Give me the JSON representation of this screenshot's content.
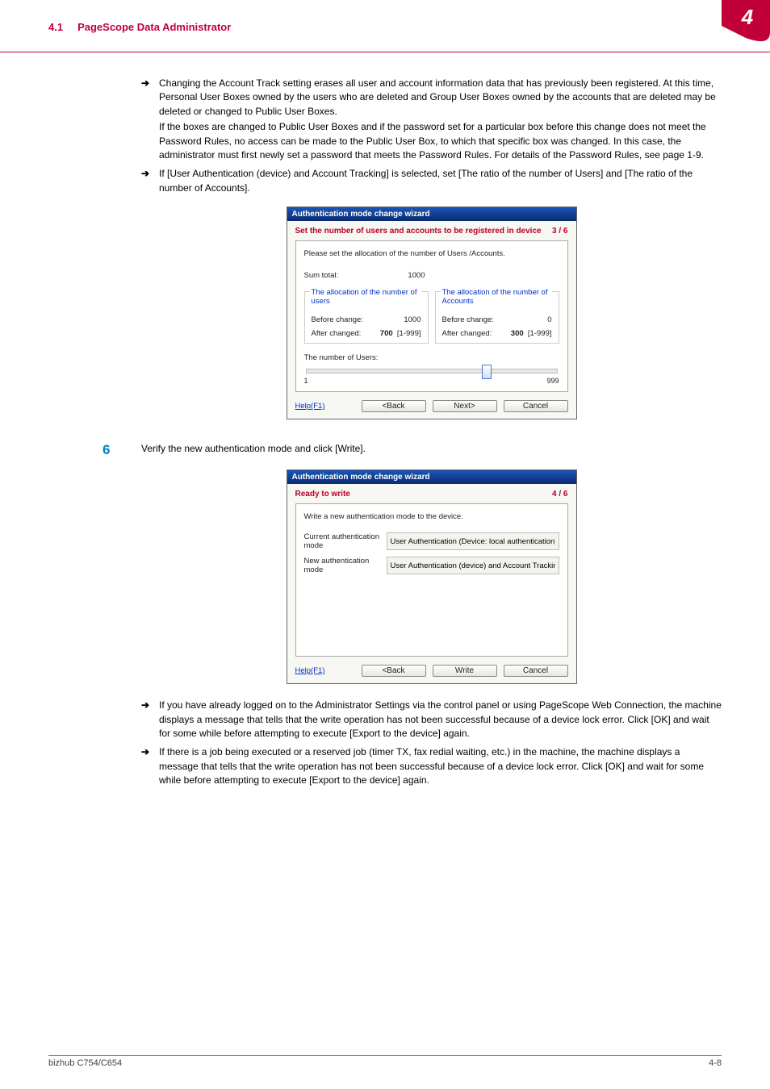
{
  "header": {
    "section_num": "4.1",
    "section_title": "PageScope Data Administrator",
    "tab_num": "4"
  },
  "bullets": {
    "b1": "Changing the Account Track setting erases all user and account information data that has previously been registered. At this time, Personal User Boxes owned by the users who are deleted and Group User Boxes owned by the accounts that are deleted may be deleted or changed to Public User Boxes.",
    "b1_cont": "If the boxes are changed to Public User Boxes and if the password set for a particular box before this change does not meet the Password Rules, no access can be made to the Public User Box, to which that specific box was changed. In this case, the administrator must first newly set a password that meets the Password Rules. For details of the Password Rules, see page 1-9.",
    "b2": "If [User Authentication (device) and Account Tracking] is selected, set [The ratio of the number of Users] and [The ratio of the number of Accounts].",
    "b3": "If you have already logged on to the Administrator Settings via the control panel or using PageScope Web Connection, the machine displays a message that tells that the write operation has not been successful because of a device lock error. Click [OK] and wait for some while before attempting to execute [Export to the device] again.",
    "b4": "If there is a job being executed or a reserved job (timer TX, fax redial waiting, etc.) in the machine, the machine displays a message that tells that the write operation has not been successful because of a device lock error. Click [OK] and wait for some while before attempting to execute [Export to the device] again."
  },
  "step6": {
    "num": "6",
    "text": "Verify the new authentication mode and click [Write]."
  },
  "dlg1": {
    "title": "Authentication mode change wizard",
    "head": "Set the number of users and accounts to be registered in device",
    "page": "3 / 6",
    "prompt": "Please set the allocation of the number of Users /Accounts.",
    "sum_label": "Sum total:",
    "sum_val": "1000",
    "g1_title": "The allocation of the number of users",
    "g2_title": "The allocation of the number of Accounts",
    "before": "Before change:",
    "after": "After changed:",
    "g1_before": "1000",
    "g1_after": "700",
    "g1_range": "[1-999]",
    "g2_before": "0",
    "g2_after": "300",
    "g2_range": "[1-999]",
    "slider_label": "The number of Users:",
    "smin": "1",
    "smax": "999",
    "help": "Help(F1)",
    "back": "<Back",
    "next": "Next>",
    "cancel": "Cancel"
  },
  "dlg2": {
    "title": "Authentication mode change wizard",
    "head": "Ready to write",
    "page": "4 / 6",
    "prompt": "Write a new authentication mode to the device.",
    "cur_label": "Current authentication mode",
    "cur_val": "User Authentication (Device: local authentication)",
    "new_label": "New authentication mode",
    "new_val": "User Authentication (device) and Account Tracking",
    "help": "Help(F1)",
    "back": "<Back",
    "write": "Write",
    "cancel": "Cancel"
  },
  "footer": {
    "left": "bizhub C754/C654",
    "right": "4-8"
  }
}
